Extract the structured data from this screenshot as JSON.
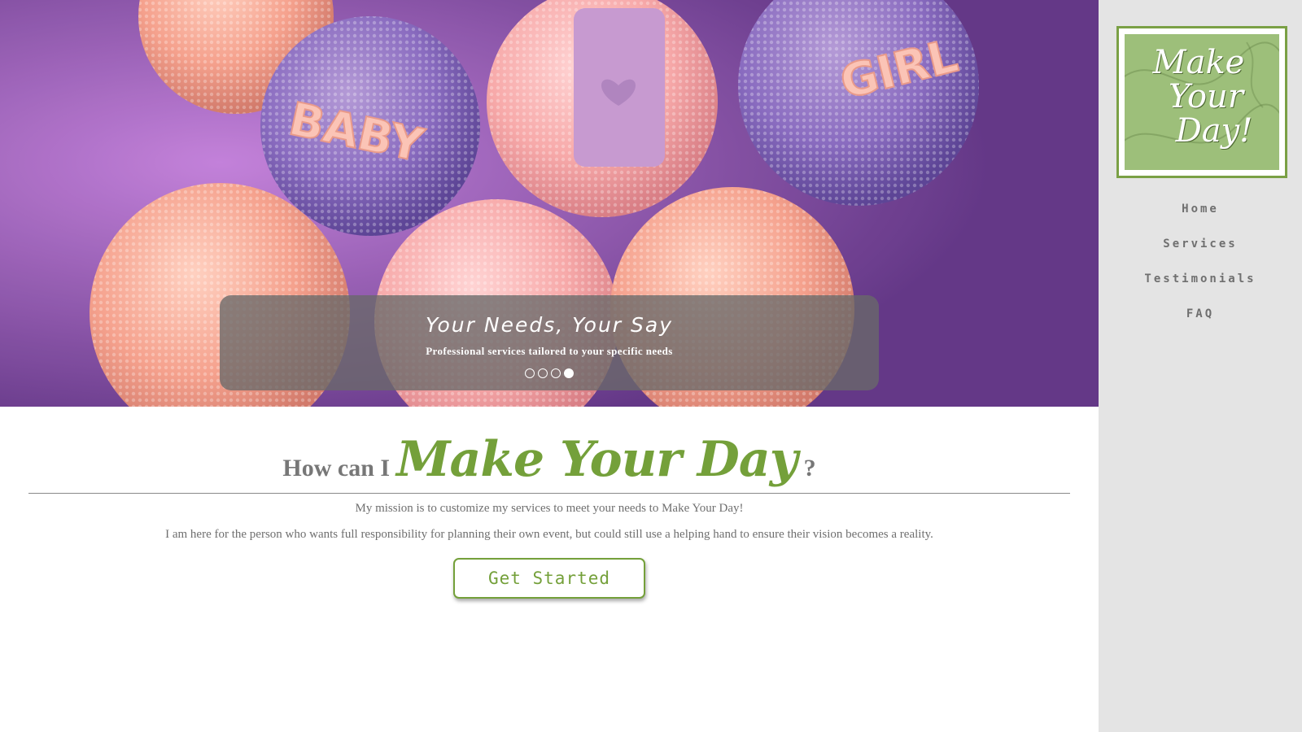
{
  "hero": {
    "slide_title": "Your Needs, Your Say",
    "slide_subtitle": "Professional services tailored to your specific needs",
    "slide_count": 4,
    "active_slide": 4,
    "image_subject": "cake pops with BABY and GIRL toppers",
    "topper_text_baby": "BABY",
    "topper_text_girl": "GIRL"
  },
  "content": {
    "headline_prefix": "How can I",
    "headline_brand": "Make Your Day",
    "headline_suffix": "?",
    "mission_text": "My mission is to customize my services to meet your needs to Make Your Day!",
    "about_text": "I am here for the person who wants full responsibility for planning their own event, but could still use a helping hand to ensure their vision becomes a reality.",
    "cta_label": "Get Started"
  },
  "sidebar": {
    "logo_lines": [
      "Make",
      "Your",
      "Day!"
    ],
    "nav": [
      {
        "label": "Home"
      },
      {
        "label": "Services"
      },
      {
        "label": "Testimonials"
      },
      {
        "label": "FAQ"
      }
    ]
  },
  "colors": {
    "brand_green": "#74a03a",
    "sidebar_bg": "#e4e4e4",
    "text_gray": "#6f6f6f",
    "logo_bg": "#9dbf7a"
  }
}
